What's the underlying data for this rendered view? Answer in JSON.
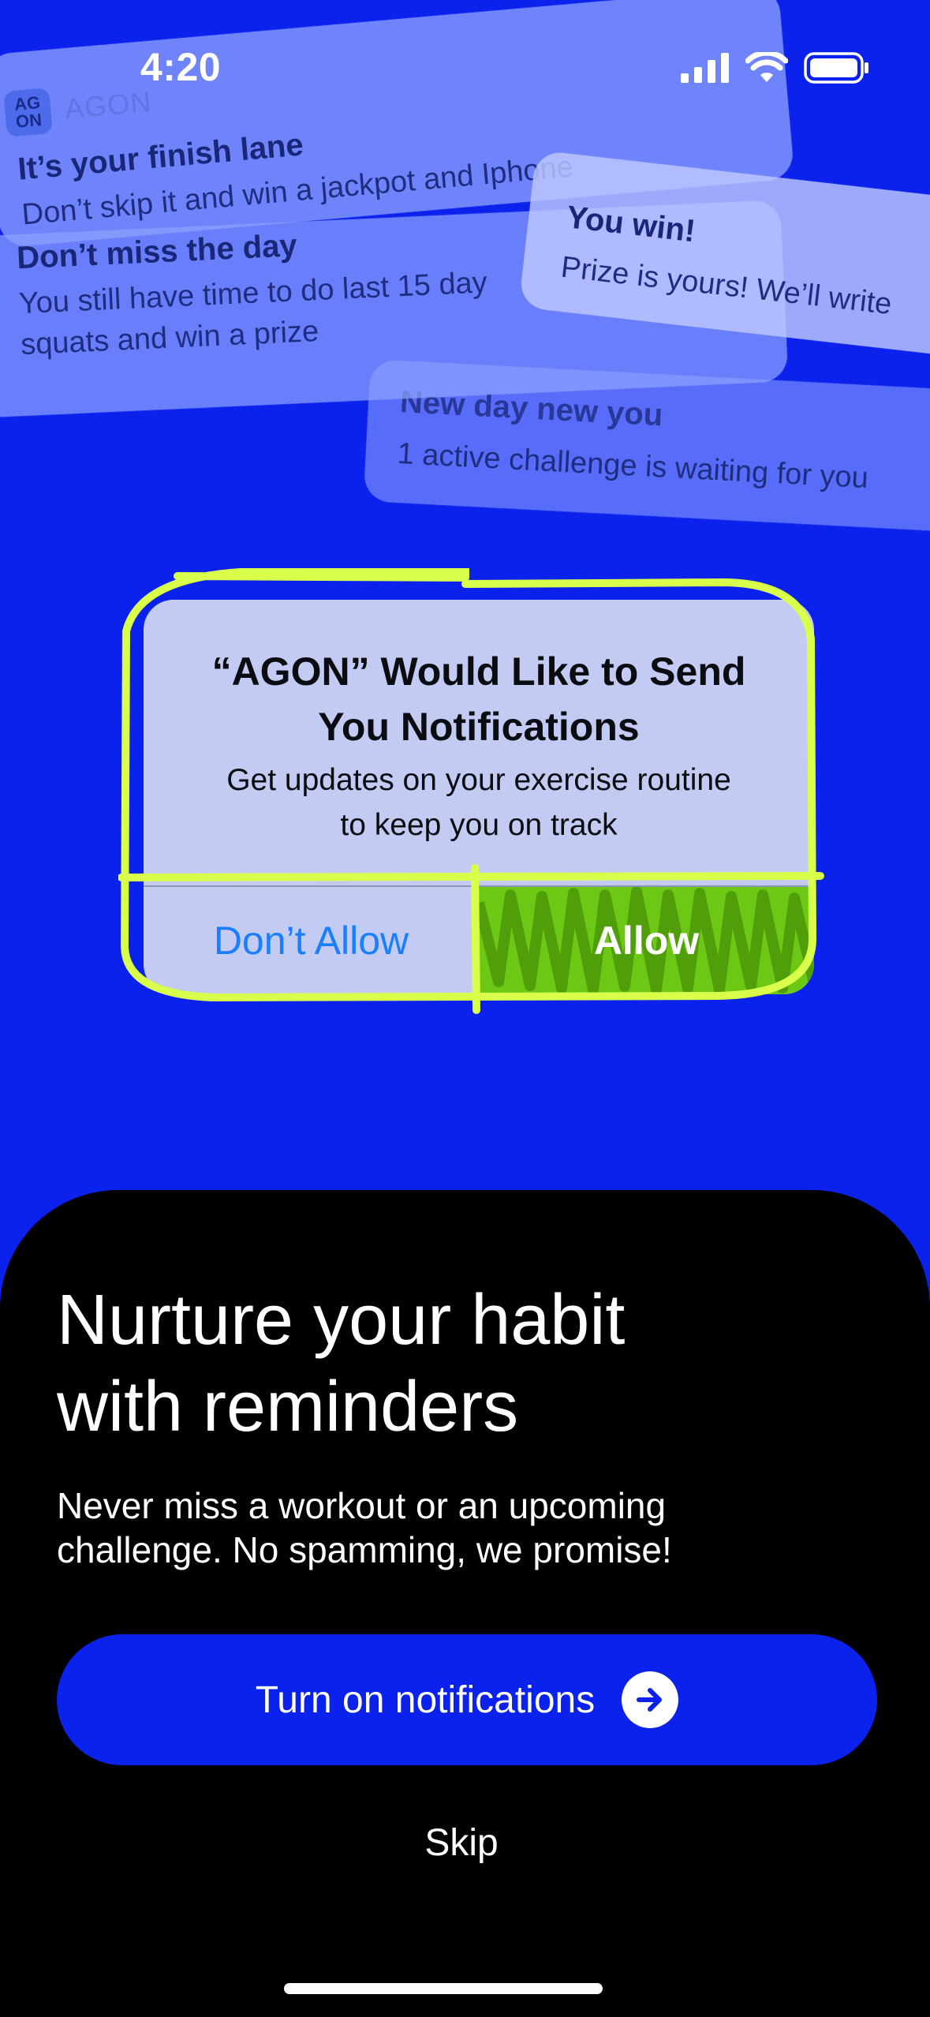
{
  "status_bar": {
    "time": "4:20"
  },
  "background_notifications": [
    {
      "app_name": "AGON",
      "app_logo": "AG ON",
      "title": "It’s your finish lane",
      "body": "Don’t skip it and win a jackpot and Iphone"
    },
    {
      "title": "Don’t miss the day",
      "body_lines": [
        "You still have time to do last 15 day",
        "squats and win a prize"
      ]
    },
    {
      "title": "You win!",
      "body": "Prize is yours! We’ll write"
    },
    {
      "title": "New day new you",
      "body": "1 active challenge is waiting for you"
    }
  ],
  "alert": {
    "title_lines": [
      "“AGON” Would Like to Send",
      "You Notifications"
    ],
    "message_lines": [
      "Get updates on your exercise routine",
      "to keep you on track"
    ],
    "deny_label": "Don’t Allow",
    "allow_label": "Allow"
  },
  "onboarding": {
    "headline_lines": [
      "Nurture your habit",
      "with reminders"
    ],
    "subtext_lines": [
      "Never miss a workout or an upcoming",
      "challenge. No spamming, we promise!"
    ],
    "cta_label": "Turn on notifications",
    "skip_label": "Skip"
  },
  "colors": {
    "background": "#0a22ec",
    "highlight": "#d9ff4a",
    "allow_fill": "#6cc814",
    "sheet": "#000000",
    "deny_text": "#1a7fff"
  }
}
